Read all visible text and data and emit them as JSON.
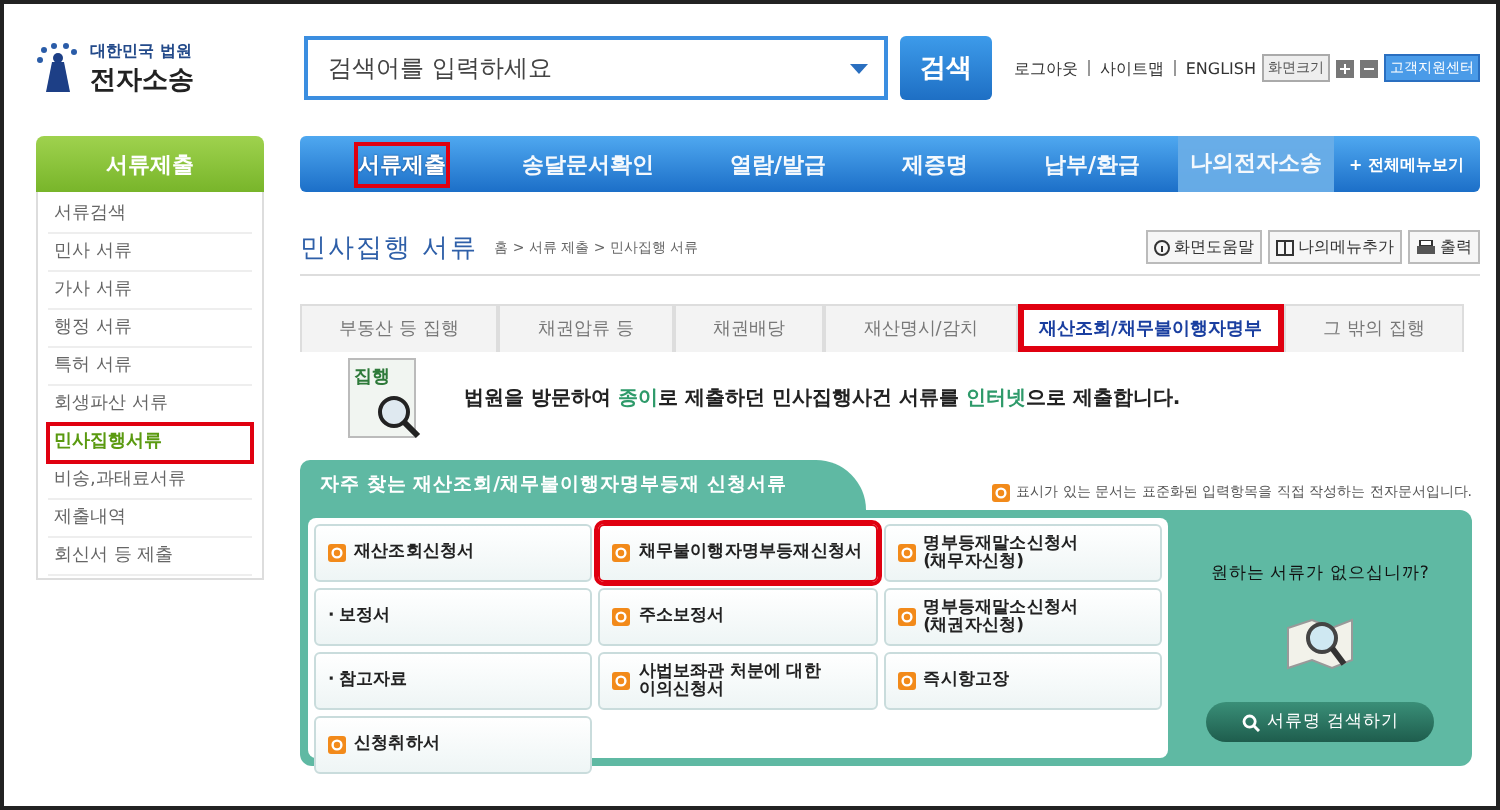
{
  "header": {
    "logo": {
      "line1": "대한민국 법원",
      "line2": "전자소송"
    },
    "search": {
      "placeholder": "검색어를 입력하세요",
      "button": "검색"
    },
    "top_links": [
      "로그아웃",
      "사이트맵",
      "ENGLISH"
    ],
    "screen_size": "화면크기",
    "support": "고객지원센터"
  },
  "nav": {
    "items": [
      {
        "label": "서류제출",
        "selected": true,
        "highlighted": true
      },
      {
        "label": "송달문서확인",
        "selected": false,
        "highlighted": false
      },
      {
        "label": "열람/발급",
        "selected": false,
        "highlighted": false
      },
      {
        "label": "제증명",
        "selected": false,
        "highlighted": false
      },
      {
        "label": "납부/환급",
        "selected": false,
        "highlighted": false
      },
      {
        "label": "나의전자소송",
        "selected": false,
        "highlighted": false
      }
    ],
    "all_menu": "+ 전체메뉴보기"
  },
  "sidebar": {
    "title": "서류제출",
    "items": [
      {
        "label": "서류검색",
        "selected": false,
        "highlighted": false
      },
      {
        "label": "민사 서류",
        "selected": false,
        "highlighted": false
      },
      {
        "label": "가사 서류",
        "selected": false,
        "highlighted": false
      },
      {
        "label": "행정 서류",
        "selected": false,
        "highlighted": false
      },
      {
        "label": "특허 서류",
        "selected": false,
        "highlighted": false
      },
      {
        "label": "회생파산 서류",
        "selected": false,
        "highlighted": false
      },
      {
        "label": "민사집행서류",
        "selected": true,
        "highlighted": true
      },
      {
        "label": "비송,과태료서류",
        "selected": false,
        "highlighted": false
      },
      {
        "label": "제출내역",
        "selected": false,
        "highlighted": false
      },
      {
        "label": "회신서 등 제출",
        "selected": false,
        "highlighted": false
      }
    ]
  },
  "page": {
    "title": "민사집행 서류",
    "breadcrumb": "홈 > 서류 제출 > 민사집행 서류",
    "tools": [
      {
        "kind": "help",
        "label": "화면도움말"
      },
      {
        "kind": "bookmark",
        "label": "나의메뉴추가"
      },
      {
        "kind": "print",
        "label": "출력"
      }
    ],
    "tabs": [
      {
        "label": "부동산 등 집행",
        "selected": false,
        "highlighted": false
      },
      {
        "label": "채권압류 등",
        "selected": false,
        "highlighted": false
      },
      {
        "label": "채권배당",
        "selected": false,
        "highlighted": false
      },
      {
        "label": "재산명시/감치",
        "selected": false,
        "highlighted": false
      },
      {
        "label": "재산조회/채무불이행자명부",
        "selected": true,
        "highlighted": true
      },
      {
        "label": "그 밖의 집행",
        "selected": false,
        "highlighted": false
      }
    ],
    "notice": {
      "badge": "집행",
      "parts": [
        {
          "text": "법원을 방문하여 ",
          "emphasis": false
        },
        {
          "text": "종이",
          "emphasis": true
        },
        {
          "text": "로 제출하던 민사집행사건 서류를 ",
          "emphasis": false
        },
        {
          "text": "인터넷",
          "emphasis": true
        },
        {
          "text": "으로 제출합니다.",
          "emphasis": false
        }
      ]
    }
  },
  "panel": {
    "title": "자주 찾는 재산조회/채무불이행자명부등재 신청서류",
    "legend": "표시가 있는 문서는 표준화된 입력항목을 직접 작성하는 전자문서입니다.",
    "forms": [
      {
        "label": "재산조회신청서",
        "kind": "electronic",
        "highlighted": false
      },
      {
        "label": "채무불이행자명부등재신청서",
        "kind": "electronic",
        "highlighted": true
      },
      {
        "label": "명부등재말소신청서\n(채무자신청)",
        "kind": "electronic",
        "highlighted": false
      },
      {
        "label": "· 보정서",
        "kind": "plain",
        "highlighted": false
      },
      {
        "label": "주소보정서",
        "kind": "electronic",
        "highlighted": false
      },
      {
        "label": "명부등재말소신청서\n(채권자신청)",
        "kind": "electronic",
        "highlighted": false
      },
      {
        "label": "· 참고자료",
        "kind": "plain",
        "highlighted": false
      },
      {
        "label": "사법보좌관 처분에 대한\n이의신청서",
        "kind": "electronic",
        "highlighted": false
      },
      {
        "label": "즉시항고장",
        "kind": "electronic",
        "highlighted": false
      },
      {
        "label": "신청취하서",
        "kind": "electronic",
        "highlighted": false
      }
    ],
    "side": {
      "question": "원하는 서류가 없으십니까?",
      "button": "서류명 검색하기"
    }
  }
}
